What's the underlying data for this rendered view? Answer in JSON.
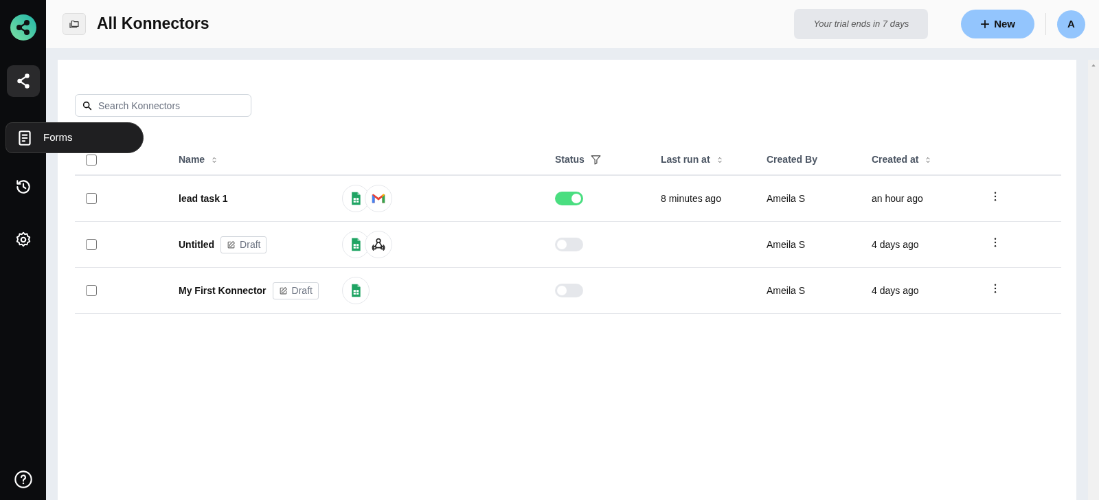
{
  "sidebar": {
    "items": [
      {
        "kind": "konnectors",
        "selected": true
      },
      {
        "kind": "history",
        "selected": false
      },
      {
        "kind": "settings",
        "selected": false
      }
    ],
    "tooltip": "Forms"
  },
  "header": {
    "title": "All Konnectors",
    "trial_notice": "Your trial ends in 7 days",
    "new_button": "New",
    "avatar": "A"
  },
  "search": {
    "placeholder": "Search Konnectors"
  },
  "table": {
    "select_all": {
      "checked": false
    },
    "columns": [
      {
        "label": "Name",
        "kind": "sort"
      },
      {
        "label": "Status",
        "kind": "filter"
      },
      {
        "label": "Last run at",
        "kind": "sort"
      },
      {
        "label": "Created By",
        "kind": "plain"
      },
      {
        "label": "Created at",
        "kind": "sort"
      }
    ],
    "rows": [
      {
        "checked": false,
        "name": "lead task 1",
        "apps": [
          {
            "kind": "sheets"
          },
          {
            "kind": "gmail"
          }
        ],
        "on": true,
        "last_run": "8 minutes ago",
        "created_by": "Ameila S",
        "created_at": "an hour ago"
      },
      {
        "checked": false,
        "name": "Untitled",
        "badge": "Draft",
        "apps": [
          {
            "kind": "sheets"
          },
          {
            "kind": "webhook"
          }
        ],
        "on": false,
        "created_by": "Ameila S",
        "created_at": "4 days ago"
      },
      {
        "checked": false,
        "name": "My First Konnector",
        "badge": "Draft",
        "apps": [
          {
            "kind": "sheets"
          }
        ],
        "on": false,
        "created_by": "Ameila S",
        "created_at": "4 days ago"
      }
    ]
  }
}
